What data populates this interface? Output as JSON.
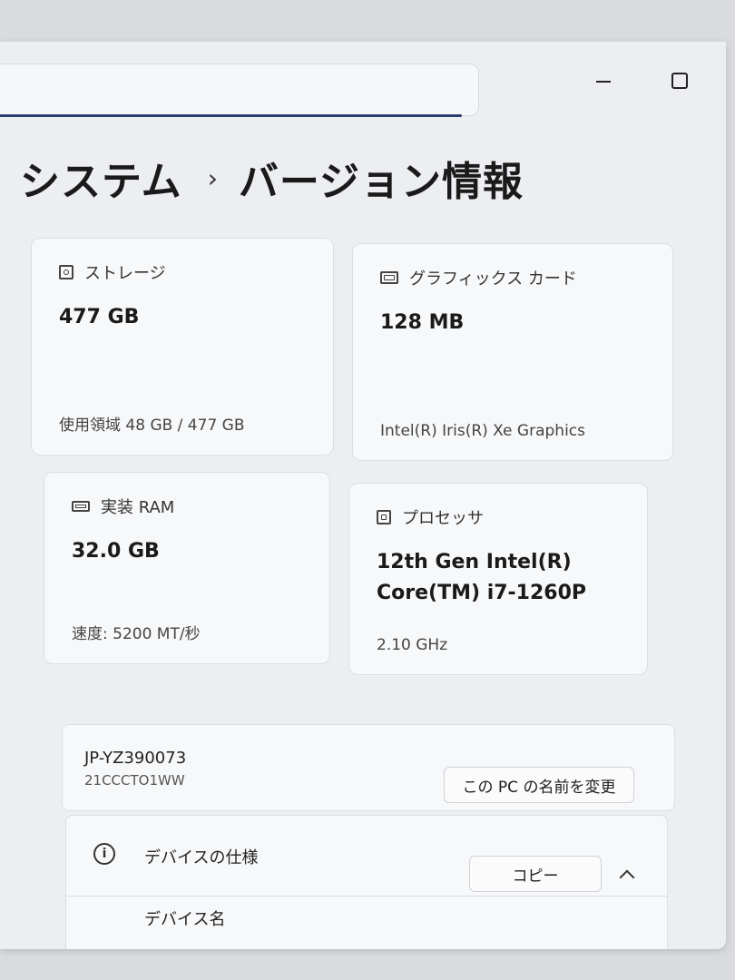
{
  "breadcrumb": {
    "parent": "システム",
    "separator": "›",
    "current": "バージョン情報"
  },
  "cards": {
    "storage": {
      "icon": "storage-icon",
      "label": "ストレージ",
      "value": "477 GB",
      "detail": "使用領域 48 GB / 477 GB"
    },
    "graphics": {
      "icon": "graphics-card-icon",
      "label": "グラフィックス カード",
      "value": "128 MB",
      "detail": "Intel(R) Iris(R) Xe Graphics"
    },
    "ram": {
      "icon": "memory-icon",
      "label": "実装 RAM",
      "value": "32.0 GB",
      "detail": "速度: 5200 MT/秒"
    },
    "processor": {
      "icon": "processor-icon",
      "label": "プロセッサ",
      "value_line1": "12th Gen Intel(R)",
      "value_line2": "Core(TM) i7-1260P",
      "detail": "2.10 GHz"
    }
  },
  "device": {
    "name": "JP-YZ390073",
    "model": "21CCCTO1WW",
    "rename_button": "この PC の名前を変更"
  },
  "specs": {
    "title": "デバイスの仕様",
    "copy_button": "コピー",
    "first_row_label": "デバイス名"
  },
  "colors": {
    "accent": "#2b3e6e",
    "background": "#eceef1",
    "card": "#f7f8fa"
  }
}
